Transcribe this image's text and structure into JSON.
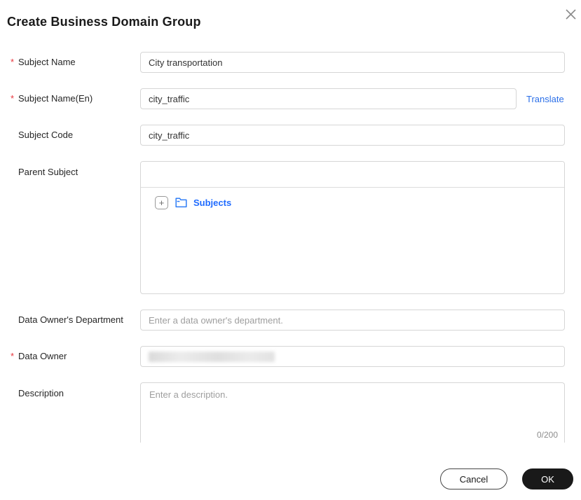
{
  "dialog": {
    "title": "Create Business Domain Group"
  },
  "fields": {
    "subject_name": {
      "label": "Subject Name",
      "required_marker": "*",
      "value": "City transportation"
    },
    "subject_name_en": {
      "label": "Subject Name(En)",
      "required_marker": "*",
      "value": "city_traffic",
      "translate_label": "Translate"
    },
    "subject_code": {
      "label": "Subject Code",
      "value": "city_traffic"
    },
    "parent_subject": {
      "label": "Parent Subject",
      "selected_value": "",
      "tree": {
        "expander_glyph": "+",
        "root_label": "Subjects"
      }
    },
    "data_owner_department": {
      "label": "Data Owner's Department",
      "placeholder": "Enter a data owner's department."
    },
    "data_owner": {
      "label": "Data Owner",
      "required_marker": "*",
      "value_redacted": true
    },
    "description": {
      "label": "Description",
      "placeholder": "Enter a description.",
      "counter": "0/200"
    }
  },
  "footer": {
    "cancel_label": "Cancel",
    "ok_label": "OK"
  },
  "colors": {
    "accent_blue": "#2b6fe8",
    "tree_blue": "#1f6bff",
    "required_red": "#e8363d",
    "ok_button_bg": "#191919",
    "input_border": "#d6d6d6"
  }
}
